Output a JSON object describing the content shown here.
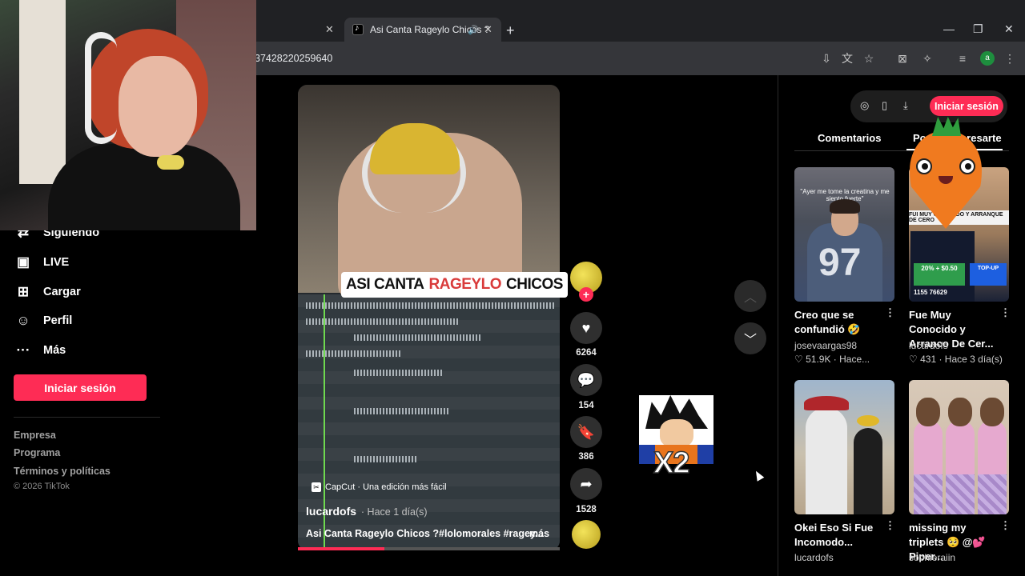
{
  "browser": {
    "tabs": [
      {
        "label": "",
        "close": "✕"
      },
      {
        "label": "Asi Canta Rageylo Chicos ?",
        "close": "✕",
        "audio": "🔊"
      }
    ],
    "new_tab": "+",
    "window_controls": {
      "minimize": "—",
      "restore": "❐",
      "close": "✕"
    },
    "url": "37428220259640",
    "profile_initial": "a"
  },
  "sidebar": {
    "items": [
      {
        "label": "Siguiendo",
        "icon": "following-icon",
        "glyph": "⇄"
      },
      {
        "label": "LIVE",
        "icon": "live-icon",
        "glyph": "▣"
      },
      {
        "label": "Cargar",
        "icon": "upload-icon",
        "glyph": "⊞"
      },
      {
        "label": "Perfil",
        "icon": "profile-icon",
        "glyph": "☺"
      },
      {
        "label": "Más",
        "icon": "more-icon",
        "glyph": "···"
      }
    ],
    "login_button": "Iniciar sesión",
    "footer": [
      "Empresa",
      "Programa",
      "Términos y políticas"
    ],
    "copyright": "© 2026 TikTok"
  },
  "video": {
    "caption_pre": "ASI CANTA",
    "caption_highlight": "RAGEYLO",
    "caption_post": "CHICOS",
    "capcut": "CapCut · Una edición más fácil",
    "author": "lucardofs",
    "author_time": "· Hace 1 día(s)",
    "description": "Asi Canta Rageylo Chicos ?#lolomorales #ragey...",
    "more": "más",
    "progress": 0.33
  },
  "actions": {
    "likes": "6264",
    "comments": "154",
    "saves": "386",
    "shares": "1528",
    "follow_plus": "+"
  },
  "sticker_text": "X2",
  "right_panel": {
    "login_button": "Iniciar sesión",
    "tabs": [
      "Comentarios",
      "Podría interesarte"
    ],
    "cards": [
      {
        "title": "Creo que se confundió 🤣",
        "user": "josevaargas98",
        "likes": "51.9K",
        "time": "Hace...",
        "overlay": "\"Ayer me tome la creatina y me siento fuerte\"",
        "number": "97"
      },
      {
        "title": "Fue Muy Conocido y Arranco De Cer...",
        "user": "lucardofs",
        "likes": "431",
        "time": "Hace 3 día(s)",
        "banner": "FUI MUY CONOCIDO Y ARRANQUE DE CERO",
        "promo": "20% + $0.50",
        "promo2": "TOP-UP",
        "stats": "1155    76629"
      },
      {
        "title": "Okei Eso Si Fue Incomodo...",
        "user": "lucardofs"
      },
      {
        "title": "missing my triplets 🥺 @💕Piper...",
        "user": "sophieraiin"
      }
    ]
  },
  "colors": {
    "accent": "#fe2c55",
    "background": "#000000"
  }
}
